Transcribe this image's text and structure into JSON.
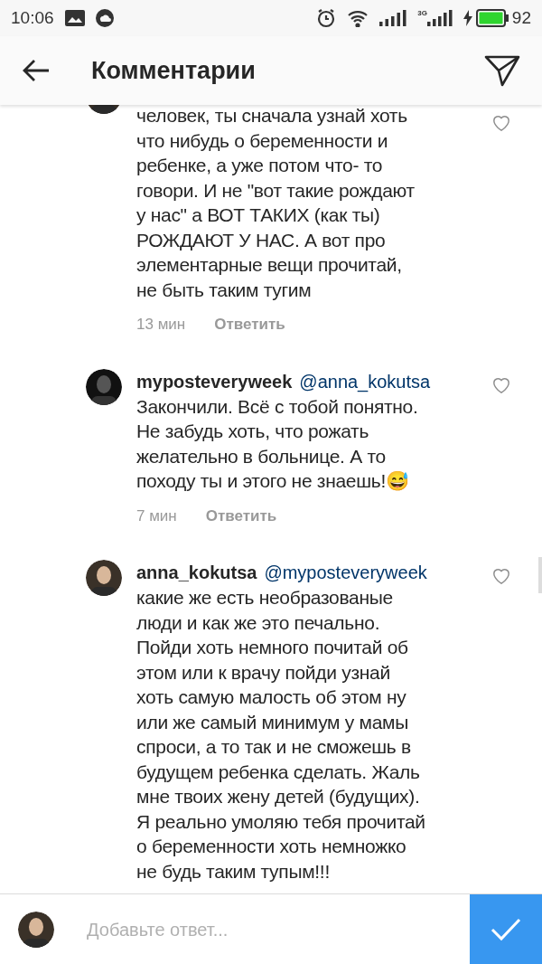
{
  "status_bar": {
    "time": "10:06",
    "network": "3G",
    "battery": "92"
  },
  "header": {
    "title": "Комментарии"
  },
  "comments": [
    {
      "kind": "cut",
      "text": "человек, ты сначала узнай хоть\nчто нибудь о беременности и\nребенке, а уже потом что- то\nговори. И не \"вот такие рождают\nу нас\" а ВОТ ТАКИХ (как ты)\nРОЖДАЮТ У НАС. А вот про\nэлементарные вещи прочитай,\nне быть таким тугим",
      "time": "13 мин",
      "reply": "Ответить"
    },
    {
      "kind": "full",
      "username": "myposteveryweek",
      "mention": "@anna_kokutsa",
      "text": "Закончили. Всё с тобой понятно.\nНе забудь хоть, что рожать\nжелательно в больнице. А то\nпоходу ты и этого не знаешь!😅",
      "time": "7 мин",
      "reply": "Ответить"
    },
    {
      "kind": "full",
      "username": "anna_kokutsa",
      "mention": "@myposteveryweek",
      "text": "какие же есть необразованые\nлюди и как же это печально.\nПойди хоть немного почитай об\nэтом или к врачу пойди узнай\nхоть самую малость об этом ну\nили же самый минимум у мамы\nспроси, а то так и не сможешь в\nбудущем ребенка сделать. Жаль\nмне твоих жену детей (будущих).\nЯ реально умоляю тебя прочитай\nо беременности хоть немножко\nне будь таким тупым!!!"
    }
  ],
  "composer": {
    "placeholder": "Добавьте ответ..."
  }
}
